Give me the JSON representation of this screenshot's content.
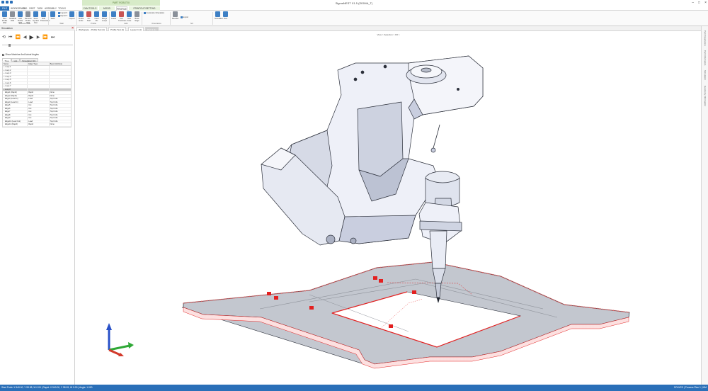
{
  "window": {
    "title": "SigmaNEST X1.5 (SIGMA_T)",
    "contextual_tab_group": "PART ROBOTIX"
  },
  "ribbon_tabs": [
    "FILE",
    "WORKSPACE",
    "CAD",
    "PART",
    "TASK",
    "ASSEMBLY",
    "TOOLS HELP",
    "CAM TOOLS",
    "MOOD DRAWS",
    "PROFILE",
    "PRINTOUT/SETTING"
  ],
  "ribbon": {
    "buttons": [
      {
        "label": "New Profile Wall",
        "icon": "new-profile-icon"
      },
      {
        "label": "Add/Edit Wall",
        "icon": "edit-wall-icon"
      },
      {
        "label": "Add Profile Wall",
        "icon": "add-profile-icon"
      },
      {
        "label": "Remove Profile Wall",
        "icon": "remove-profile-icon"
      },
      {
        "label": "Save Symbol Part",
        "icon": "save-symbol-icon"
      },
      {
        "label": "Edit Parameters",
        "icon": "edit-parameters-icon"
      },
      {
        "label": "Weld",
        "icon": "weld-icon"
      },
      {
        "label": "Inspect",
        "icon": "inspect-icon"
      },
      {
        "label": "Profile Ends",
        "icon": "profile-ends-icon"
      },
      {
        "label": "NC Start",
        "icon": "nc-start-icon"
      },
      {
        "label": "Clear NC",
        "icon": "clear-nc-icon"
      },
      {
        "label": "Merge Loops",
        "icon": "merge-loops-icon"
      },
      {
        "label": "Leads",
        "icon": "leads-icon"
      },
      {
        "label": "Sort Transition",
        "icon": "sort-transition-icon"
      },
      {
        "label": "New Face",
        "icon": "new-face-icon"
      },
      {
        "label": "Base Edge",
        "icon": "base-edge-icon"
      },
      {
        "label": "Reorder",
        "icon": "reorder-icon"
      },
      {
        "label": "Simulation",
        "icon": "simulation-icon"
      },
      {
        "label": "Post",
        "icon": "post-icon"
      }
    ],
    "small_items": [
      {
        "label": "Import 5",
        "icon": "import-icon"
      },
      {
        "label": "Export 5",
        "icon": "export-icon"
      },
      {
        "label": "Customize Orientation",
        "icon": "orientation-icon"
      },
      {
        "label": "Export",
        "icon": "export-nc-icon"
      }
    ],
    "groups": [
      "Process Plan",
      "Wall",
      "Profile",
      "Edit",
      "Orientation",
      "NC"
    ]
  },
  "simulation_panel": {
    "title": "Simulation",
    "checkbox_label": "Show Machine And Actual Angles",
    "tabs": [
      "Tree",
      "List",
      "Simulation NC"
    ],
    "columns": [
      "Name",
      "Edge Type",
      "Bevel Attribute"
    ],
    "rows": [
      {
        "name": "Loop 1",
        "type": "",
        "attr": "",
        "expand": "+"
      },
      {
        "name": "Loop 2",
        "type": "",
        "attr": "",
        "expand": "+"
      },
      {
        "name": "Loop 3",
        "type": "",
        "attr": "",
        "expand": "+"
      },
      {
        "name": "Loop 4",
        "type": "",
        "attr": "",
        "expand": "+"
      },
      {
        "name": "Loop 5",
        "type": "",
        "attr": "",
        "expand": "+"
      },
      {
        "name": "Loop 6",
        "type": "",
        "attr": "",
        "expand": "+"
      },
      {
        "name": "Loop 7",
        "type": "",
        "attr": "",
        "expand": "+"
      },
      {
        "name": "Loop 8",
        "type": "",
        "attr": "",
        "expand": "-"
      },
      {
        "name": "Edge1 (Rapid)",
        "type": "Rapid",
        "attr": "None",
        "expand": ""
      },
      {
        "name": "Edge2 (Rapid)",
        "type": "Rapid",
        "attr": "None",
        "expand": ""
      },
      {
        "name": "Edge3 (Lead In)",
        "type": "Lead",
        "attr": "Top Knife",
        "expand": ""
      },
      {
        "name": "Edge4 (Lead In)",
        "type": "Lead",
        "attr": "Top Knife",
        "expand": ""
      },
      {
        "name": "Edge5",
        "type": "Cut",
        "attr": "Top Knife",
        "expand": ""
      },
      {
        "name": "Edge6",
        "type": "Cut",
        "attr": "Top Knife",
        "expand": ""
      },
      {
        "name": "Edge7",
        "type": "Cut",
        "attr": "Top Knife",
        "expand": ""
      },
      {
        "name": "Edge8",
        "type": "Cut",
        "attr": "Top Knife",
        "expand": ""
      },
      {
        "name": "Edge9",
        "type": "Cut",
        "attr": "Top Knife",
        "expand": ""
      },
      {
        "name": "Edge10 (Lead Out)",
        "type": "Lead",
        "attr": "Top Knife",
        "expand": ""
      },
      {
        "name": "Edge11 (Rapid)",
        "type": "Rapid",
        "attr": "None",
        "expand": ""
      }
    ],
    "selected_row": 7
  },
  "document_tabs": [
    "Workspace - Profile Test (1)",
    "Profile Test (1)",
    "Layout 4 (1)",
    "Part 3 (1)"
  ],
  "active_document_tab": 3,
  "viewport": {
    "caption": "View > Selection > Fill >"
  },
  "right_dock_tabs": [
    "Part Parameters",
    "Part Information",
    "Simulation",
    "Geometry Information"
  ],
  "status_bar": {
    "left": "Start Point: X 540.00, Y 59.98, W 0.00 | Rapid: X 540.00, Y 98.09, W 0.00 | Angle: 1.000",
    "right": "SOLVED | Process Plan 1 | MM"
  },
  "colors": {
    "accent": "#2a6fb8",
    "context_tab": "#d7ebc8",
    "model_face": "#eef0f8",
    "model_shade": "#c9cedf",
    "model_edge": "#2b2f3a",
    "cut_highlight": "#e32020",
    "axis_x": "#2ea836",
    "axis_y": "#d33a2c",
    "axis_z": "#2850c8"
  }
}
